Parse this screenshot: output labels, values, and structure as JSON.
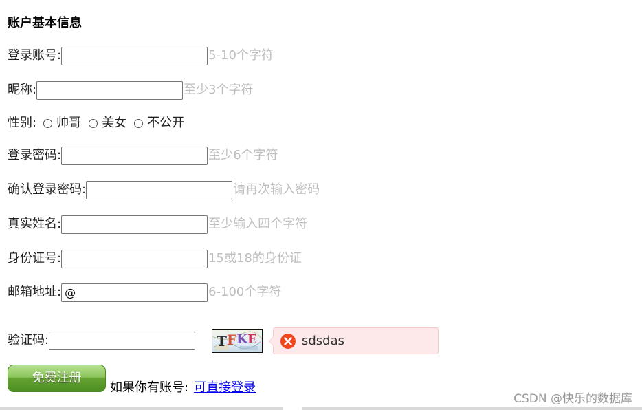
{
  "form": {
    "title": "账户基本信息",
    "fields": {
      "account": {
        "label": "登录账号:",
        "value": "",
        "hint": "5-10个字符"
      },
      "nickname": {
        "label": "昵称:",
        "value": "",
        "hint": "至少3个字符"
      },
      "gender": {
        "label": "性别:",
        "options": [
          "帅哥",
          "美女",
          "不公开"
        ]
      },
      "password": {
        "label": "登录密码:",
        "value": "",
        "hint": "至少6个字符"
      },
      "confirm_password": {
        "label": "确认登录密码:",
        "value": "",
        "hint": "请再次输入密码"
      },
      "real_name": {
        "label": "真实姓名:",
        "value": "",
        "hint": "至少输入四个字符"
      },
      "id_number": {
        "label": "身份证号:",
        "value": "",
        "hint": "15或18的身份证"
      },
      "email": {
        "label": "邮箱地址:",
        "value": "@",
        "hint": "6-100个字符"
      },
      "captcha": {
        "label": "验证码:",
        "value": "",
        "image_text": "TFKE"
      }
    },
    "error_tooltip": {
      "text": "sdsdas",
      "icon": "error-x-icon",
      "color": "#f1471d"
    },
    "register_button": "免费注册",
    "login_prompt": "如果你有账号:",
    "login_link": "可直接登录"
  },
  "watermark": "CSDN @快乐的数据库"
}
